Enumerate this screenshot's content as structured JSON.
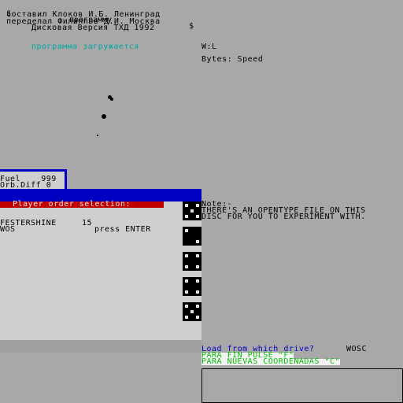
{
  "header": {
    "dollar_left": "$",
    "line1": "программу",
    "dollar_right": "$",
    "line2": "составил Клоков И.Б. Ленинград",
    "line3": "переделал Филиппов Д.И. Москва",
    "line4": "Дисковая Версия ТХД 1992"
  },
  "status": {
    "loading": "программа загружается",
    "wl": "W:L",
    "bytes": "Bytes: Speed"
  },
  "fuel_panel": {
    "fuel_label": "Fuel",
    "fuel_value": "999",
    "orb_label": "Orb.Diff",
    "orb_value": "0"
  },
  "order_panel": {
    "title": "Player order selection:",
    "player_name": "FESTERSHINE",
    "player_value": "15",
    "second_name": "WOS",
    "hint": "press ENTER"
  },
  "dice": [
    5,
    2,
    4,
    4,
    5
  ],
  "note": {
    "label": "Note:-",
    "line1": "THERE'S AN OPENTYPE FILE ON THIS",
    "line2": "DISC FOR YOU TO EXPERIMENT WITH."
  },
  "prompt": {
    "question": "Load from which drive?",
    "answer": "WOSC",
    "fin": "PARA FIN PULSE \"F\"",
    "coords": "PARA NUEVAS COORDENADAS \"C\""
  },
  "colors": {
    "background": "#a8a8a8",
    "panel": "#cfcfcf",
    "blue": "#0000c0",
    "red": "#c00000",
    "cyan": "#00a8a8",
    "green": "#00c000"
  }
}
